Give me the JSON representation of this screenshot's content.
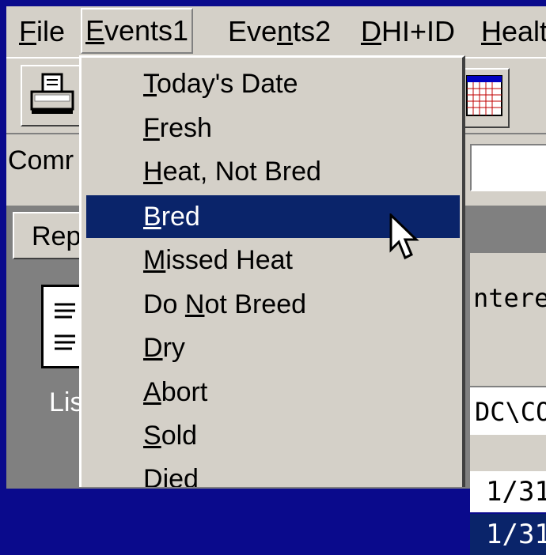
{
  "menubar": {
    "items": [
      {
        "pre": "",
        "u": "F",
        "post": "ile"
      },
      {
        "pre": "",
        "u": "E",
        "post": "vents1"
      },
      {
        "pre": "Eve",
        "u": "n",
        "post": "ts2"
      },
      {
        "pre": "",
        "u": "D",
        "post": "HI+ID"
      },
      {
        "pre": "",
        "u": "H",
        "post": "ealt"
      }
    ],
    "active_index": 1
  },
  "toolbar": {
    "print_icon": "printer-icon",
    "calendar_icon": "calendar-icon"
  },
  "command": {
    "label": "Comr"
  },
  "panel": {
    "tab_label": "Rep",
    "doc_icon": "report-document-icon",
    "list_label": "Lis",
    "entered_label": "ntere",
    "path_value": "DC\\CO",
    "date_rows": [
      "1/31",
      "1/31"
    ]
  },
  "events_menu": {
    "items": [
      {
        "pre": "",
        "u": "T",
        "post": "oday's Date"
      },
      {
        "pre": "",
        "u": "F",
        "post": "resh"
      },
      {
        "pre": "",
        "u": "H",
        "post": "eat, Not Bred"
      },
      {
        "pre": "",
        "u": "B",
        "post": "red"
      },
      {
        "pre": "",
        "u": "M",
        "post": "issed Heat"
      },
      {
        "pre": "Do ",
        "u": "N",
        "post": "ot Breed"
      },
      {
        "pre": "",
        "u": "D",
        "post": "ry"
      },
      {
        "pre": "",
        "u": "A",
        "post": "bort"
      },
      {
        "pre": "",
        "u": "S",
        "post": "old"
      },
      {
        "pre": "",
        "u": "D",
        "post": "ied"
      }
    ],
    "selected_index": 3
  },
  "colors": {
    "desktop": "#0a0a8c",
    "face": "#d4d0c8",
    "highlight": "#0a246a"
  }
}
